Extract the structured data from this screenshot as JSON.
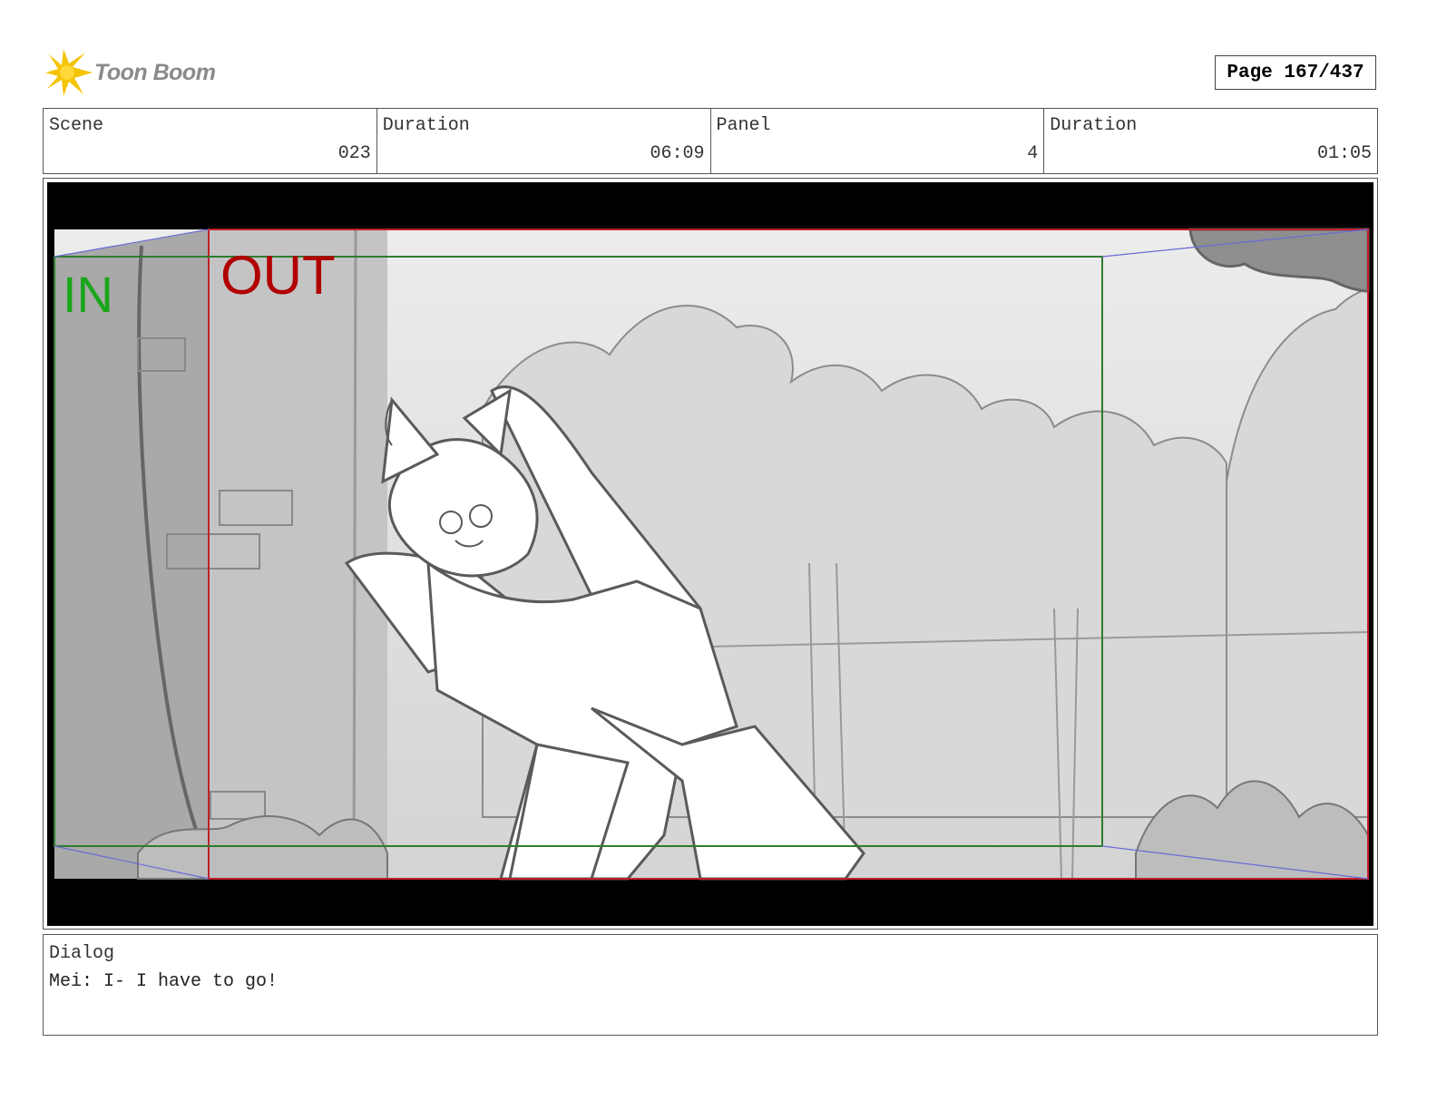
{
  "header": {
    "logo_text": "Toon Boom",
    "page_label": "Page 167/437"
  },
  "info": {
    "scene_label": "Scene",
    "scene_value": "023",
    "scene_duration_label": "Duration",
    "scene_duration_value": "06:09",
    "panel_label": "Panel",
    "panel_value": "4",
    "panel_duration_label": "Duration",
    "panel_duration_value": "01:05"
  },
  "frame": {
    "in_label": "IN",
    "out_label": "OUT",
    "in_color": "#1aa51a",
    "out_color": "#b00000",
    "camera_in_frame_color": "#2e7d2e",
    "camera_out_frame_color": "#c0202a"
  },
  "dialog": {
    "label": "Dialog",
    "text": "Mei: I- I have to go!"
  },
  "colors": {
    "logo_accent": "#f5c400",
    "logo_text": "#8a8a8a",
    "border": "#555555"
  }
}
